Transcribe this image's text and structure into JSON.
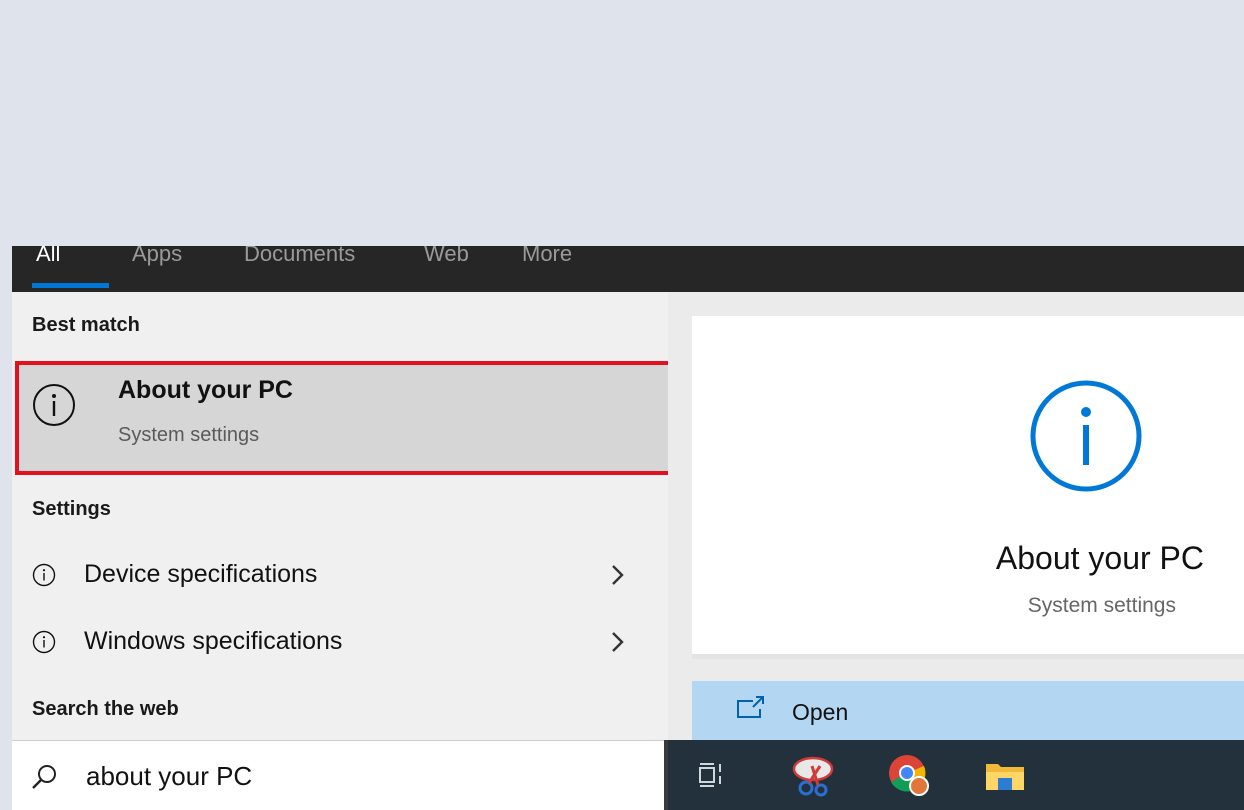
{
  "tabs": [
    {
      "label": "All",
      "active": true
    },
    {
      "label": "Apps",
      "active": false
    },
    {
      "label": "Documents",
      "active": false
    },
    {
      "label": "Web",
      "active": false
    },
    {
      "label": "More",
      "active": false
    }
  ],
  "results": {
    "best_match_heading": "Best match",
    "best_match": {
      "title": "About your PC",
      "subtitle": "System settings",
      "icon": "info-icon"
    },
    "settings_heading": "Settings",
    "settings_items": [
      {
        "label": "Device specifications",
        "icon": "info-icon"
      },
      {
        "label": "Windows specifications",
        "icon": "info-icon"
      }
    ],
    "web_heading": "Search the web"
  },
  "preview": {
    "title": "About your PC",
    "subtitle": "System settings",
    "open_label": "Open",
    "icon": "info-icon"
  },
  "search": {
    "query": "about your PC",
    "icon": "search-icon"
  },
  "taskbar": {
    "items": [
      "task-view-icon",
      "snipping-tool-icon",
      "chrome-icon",
      "file-explorer-icon"
    ]
  },
  "colors": {
    "accent": "#0078d7",
    "highlight_border": "#e1121f",
    "open_bg": "#b3d7f2",
    "taskbar_bg": "#23313d"
  }
}
